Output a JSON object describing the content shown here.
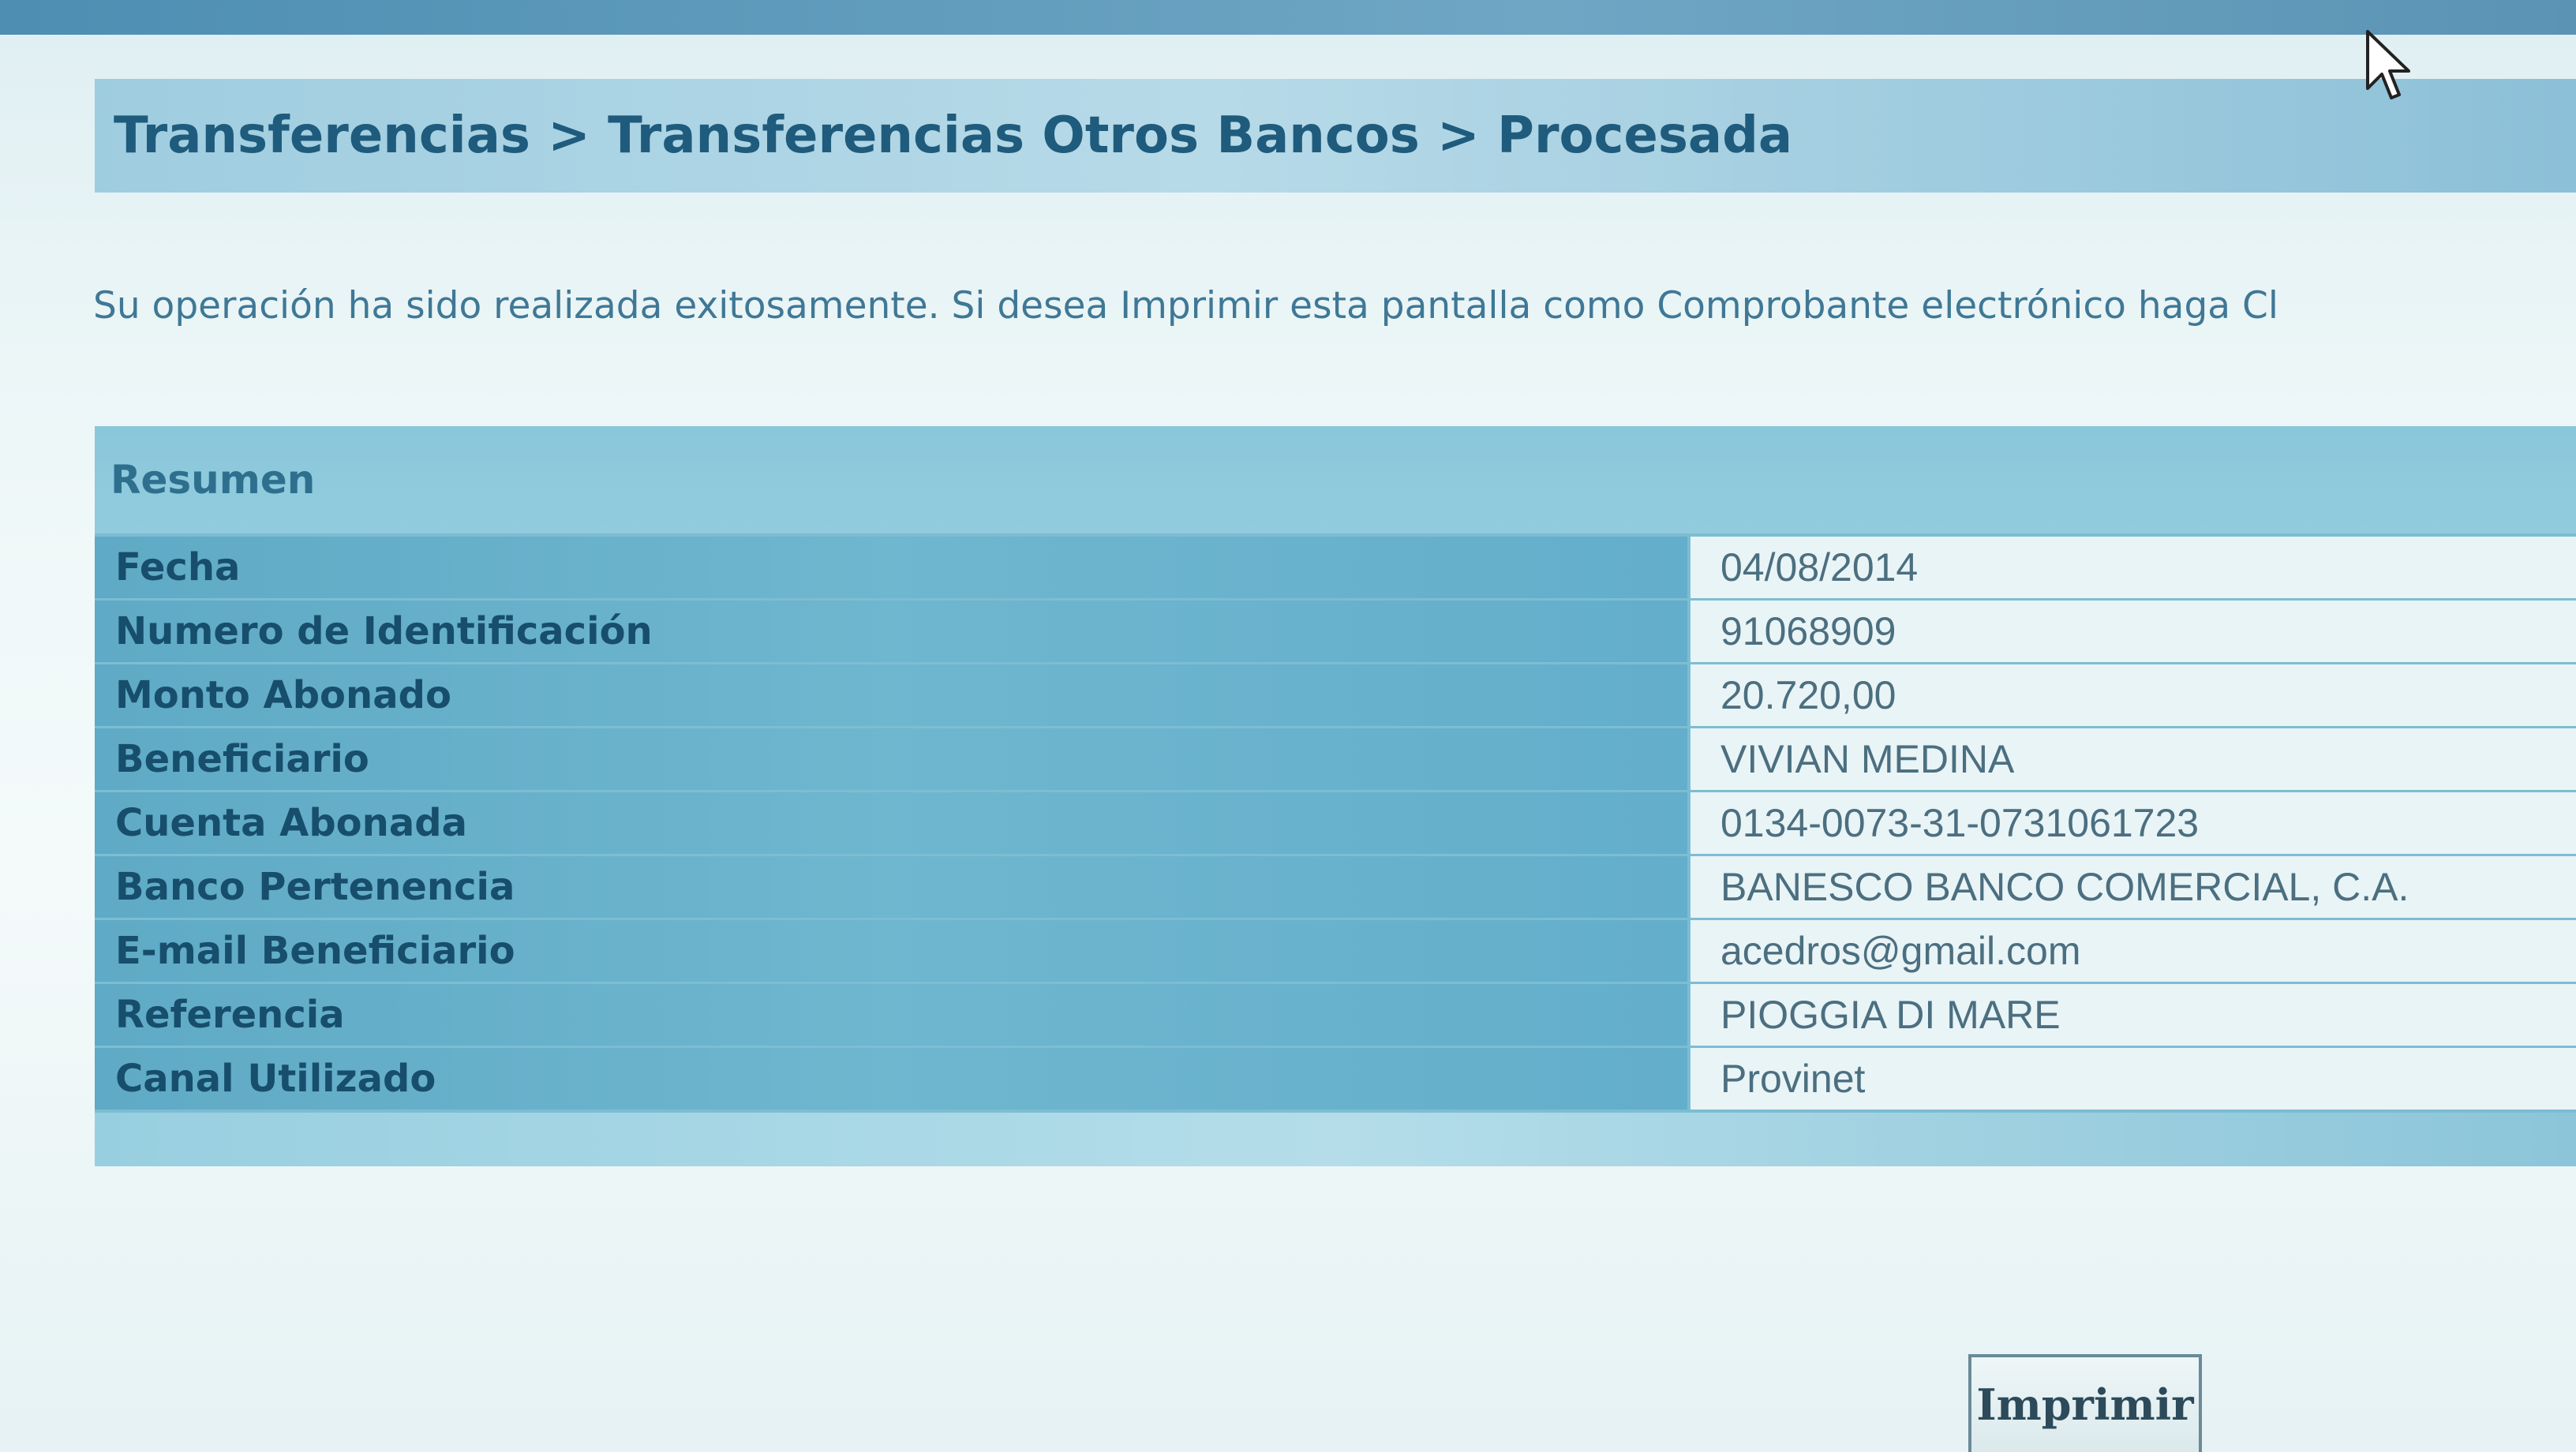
{
  "breadcrumb": "Transferencias > Transferencias Otros Bancos > Procesada",
  "message": "Su operación ha sido realizada exitosamente. Si desea Imprimir esta pantalla como Comprobante electrónico haga Cl",
  "summary": {
    "title": "Resumen",
    "rows": [
      {
        "label": "Fecha",
        "value": "04/08/2014"
      },
      {
        "label": "Numero de Identificación",
        "value": "91068909"
      },
      {
        "label": "Monto Abonado",
        "value": "20.720,00"
      },
      {
        "label": "Beneficiario",
        "value": "VIVIAN MEDINA"
      },
      {
        "label": "Cuenta Abonada",
        "value": "0134-0073-31-0731061723"
      },
      {
        "label": "Banco Pertenencia",
        "value": "BANESCO BANCO COMERCIAL, C.A."
      },
      {
        "label": "E-mail Beneficiario",
        "value": "acedros@gmail.com"
      },
      {
        "label": "Referencia",
        "value": "PIOGGIA DI MARE"
      },
      {
        "label": "Canal Utilizado",
        "value": "Provinet"
      }
    ]
  },
  "print_button": {
    "label": "Imprimir"
  },
  "icons": {
    "cursor": "mouse-pointer-icon"
  },
  "colors": {
    "header_bar": "#a8d4e4",
    "label_cell": "#64aecb",
    "value_cell": "#e9f4f6",
    "label_text": "#174e6c"
  }
}
